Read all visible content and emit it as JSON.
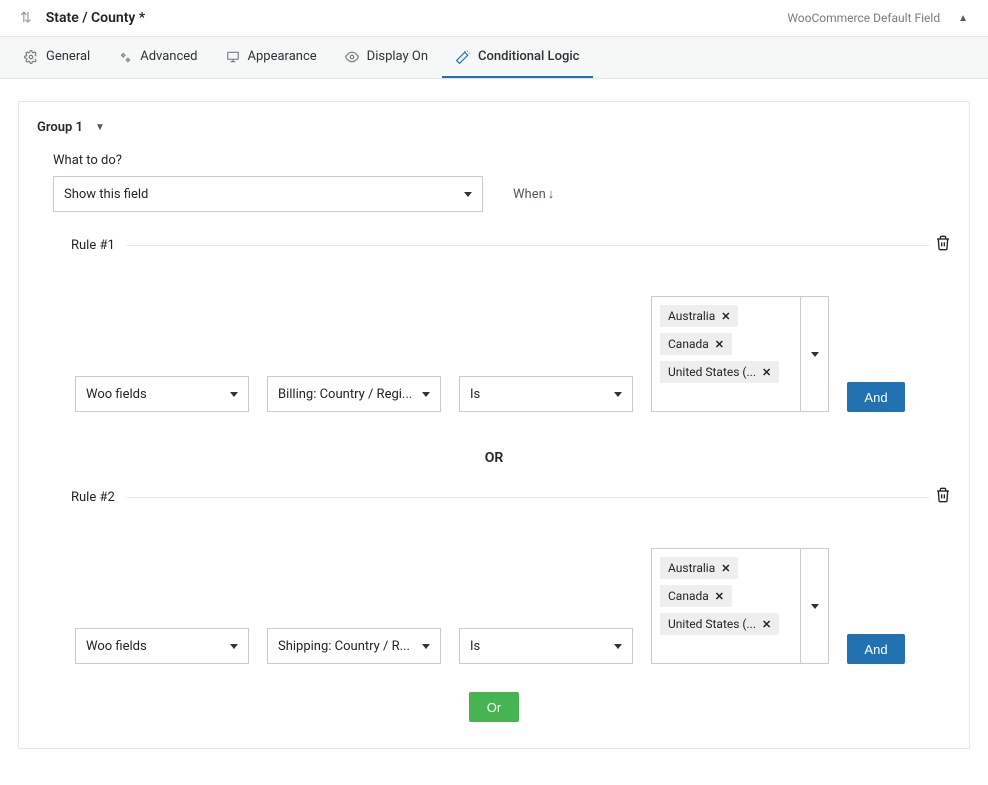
{
  "header": {
    "title": "State / County *",
    "default_label": "WooCommerce Default Field"
  },
  "tabs": {
    "general": "General",
    "advanced": "Advanced",
    "appearance": "Appearance",
    "display_on": "Display On",
    "conditional": "Conditional Logic"
  },
  "panel": {
    "group_label": "Group 1",
    "what_label": "What to do?",
    "action_value": "Show this field",
    "when_label": "When",
    "or_divider": "OR",
    "or_button": "Or",
    "and_button": "And"
  },
  "rules": [
    {
      "title": "Rule #1",
      "source": "Woo fields",
      "field": "Billing: Country / Regi...",
      "operator": "Is",
      "tags": [
        "Australia",
        "Canada",
        "United States (..."
      ]
    },
    {
      "title": "Rule #2",
      "source": "Woo fields",
      "field": "Shipping: Country / R...",
      "operator": "Is",
      "tags": [
        "Australia",
        "Canada",
        "United States (..."
      ]
    }
  ]
}
